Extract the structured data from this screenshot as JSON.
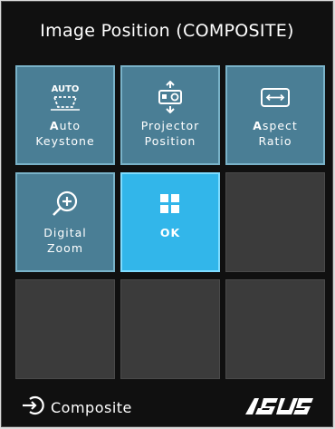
{
  "header": {
    "title": "Image Position (COMPOSITE)"
  },
  "tiles": [
    {
      "label_bold": "A",
      "label": "uto\nKeystone",
      "icon": "auto-keystone-icon",
      "icon_text": "AUTO"
    },
    {
      "label": "Projector\nPosition",
      "icon": "projector-position-icon"
    },
    {
      "label_bold": "A",
      "label": "spect\nRatio",
      "icon": "aspect-ratio-icon"
    },
    {
      "label": "Digital\nZoom",
      "icon": "digital-zoom-icon"
    },
    {
      "label": "OK",
      "icon": "ok-grid-icon",
      "selected": true
    }
  ],
  "footer": {
    "source": "Composite",
    "source_icon": "input-source-icon",
    "brand": "ASUS"
  },
  "colors": {
    "tile": "#4a7e95",
    "tile_selected": "#32b6ea",
    "empty_tile": "#3b3b3b"
  }
}
